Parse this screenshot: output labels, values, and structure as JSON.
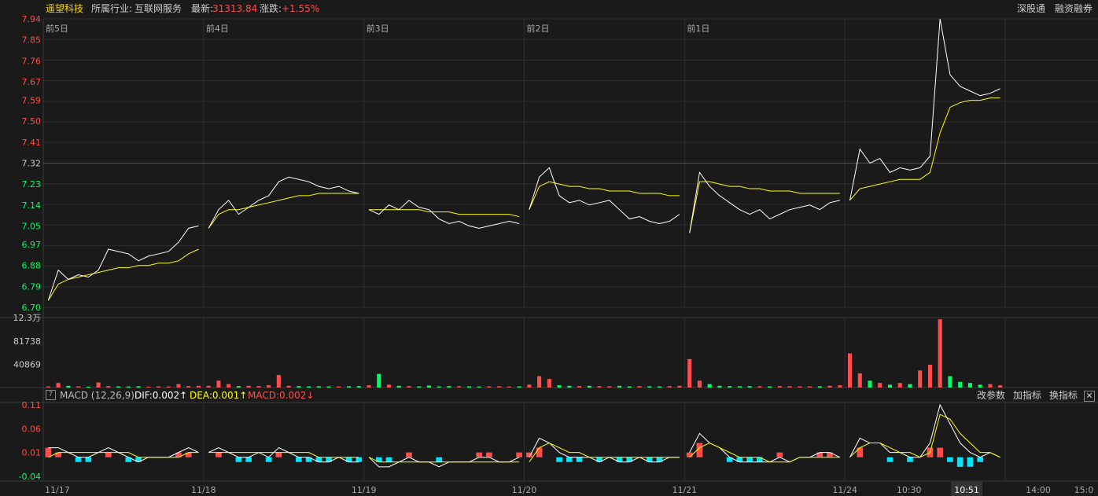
{
  "header": {
    "stock_name": "遥望科技",
    "industry_label": "所属行业:",
    "industry_value": "互联网服务",
    "latest_label": "最新:",
    "latest_value": "31313.84",
    "change_label": "涨跌:",
    "change_value": "+1.55%",
    "right_buttons": [
      "深股通",
      "融资融券"
    ]
  },
  "macd_bar": {
    "help_symbol": "?",
    "title": "MACD (12,26,9)",
    "dif": "DIF:0.002↑",
    "dea": "DEA:0.001↑",
    "macd": "MACD:0.002↓",
    "buttons": [
      "改参数",
      "加指标",
      "换指标"
    ],
    "close_symbol": "✕"
  },
  "colors": {
    "background": "#1a1a1a",
    "up": "#ff4d4d",
    "down": "#00ff66",
    "price_line": "#ffffff",
    "avg_line": "#ffff00",
    "macd_neg": "#00e5ff",
    "grid": "#2e2e2e"
  },
  "chart_data": [
    {
      "type": "line",
      "panel": "price",
      "yticks": [
        "7.94",
        "7.85",
        "7.76",
        "7.67",
        "7.59",
        "7.50",
        "7.41",
        "7.32",
        "7.23",
        "7.14",
        "7.05",
        "6.97",
        "6.88",
        "6.79",
        "6.70"
      ],
      "ylim": [
        6.7,
        7.94
      ],
      "reference_price": 7.32,
      "day_labels": [
        "前5日",
        "前4日",
        "前3日",
        "前2日",
        "前1日"
      ],
      "xticks": [
        "11/17",
        "11/18",
        "11/19",
        "11/20",
        "11/21",
        "11/24",
        "10:30",
        "10:51",
        "14:00",
        "15:0"
      ],
      "days": [
        {
          "price": [
            6.73,
            6.86,
            6.82,
            6.84,
            6.83,
            6.86,
            6.95,
            6.94,
            6.93,
            6.9,
            6.92,
            6.93,
            6.94,
            6.98,
            7.04,
            7.05
          ],
          "avg": [
            6.73,
            6.8,
            6.82,
            6.83,
            6.84,
            6.85,
            6.86,
            6.87,
            6.87,
            6.88,
            6.88,
            6.89,
            6.89,
            6.9,
            6.93,
            6.95
          ]
        },
        {
          "price": [
            7.04,
            7.12,
            7.16,
            7.1,
            7.13,
            7.16,
            7.18,
            7.24,
            7.26,
            7.25,
            7.24,
            7.22,
            7.21,
            7.22,
            7.2,
            7.19
          ],
          "avg": [
            7.04,
            7.1,
            7.12,
            7.12,
            7.13,
            7.14,
            7.15,
            7.16,
            7.17,
            7.18,
            7.18,
            7.19,
            7.19,
            7.19,
            7.19,
            7.19
          ]
        },
        {
          "price": [
            7.12,
            7.1,
            7.14,
            7.12,
            7.16,
            7.13,
            7.12,
            7.08,
            7.06,
            7.07,
            7.05,
            7.04,
            7.05,
            7.06,
            7.07,
            7.06
          ],
          "avg": [
            7.12,
            7.12,
            7.12,
            7.12,
            7.12,
            7.12,
            7.11,
            7.11,
            7.11,
            7.1,
            7.1,
            7.1,
            7.1,
            7.1,
            7.1,
            7.09
          ]
        },
        {
          "price": [
            7.12,
            7.26,
            7.3,
            7.18,
            7.15,
            7.16,
            7.14,
            7.15,
            7.16,
            7.12,
            7.08,
            7.09,
            7.07,
            7.06,
            7.07,
            7.1
          ],
          "avg": [
            7.12,
            7.22,
            7.24,
            7.23,
            7.22,
            7.22,
            7.21,
            7.21,
            7.2,
            7.2,
            7.2,
            7.19,
            7.19,
            7.19,
            7.18,
            7.18
          ]
        },
        {
          "price": [
            7.02,
            7.28,
            7.22,
            7.18,
            7.15,
            7.12,
            7.1,
            7.12,
            7.08,
            7.1,
            7.12,
            7.13,
            7.14,
            7.12,
            7.15,
            7.16
          ],
          "avg": [
            7.02,
            7.24,
            7.24,
            7.23,
            7.22,
            7.22,
            7.21,
            7.21,
            7.2,
            7.2,
            7.2,
            7.19,
            7.19,
            7.19,
            7.19,
            7.19
          ]
        },
        {
          "price": [
            7.16,
            7.38,
            7.32,
            7.34,
            7.28,
            7.3,
            7.29,
            7.3,
            7.35,
            7.94,
            7.7,
            7.65,
            7.63,
            7.61,
            7.62,
            7.64
          ],
          "avg": [
            7.16,
            7.21,
            7.22,
            7.23,
            7.24,
            7.25,
            7.25,
            7.25,
            7.28,
            7.45,
            7.56,
            7.58,
            7.59,
            7.59,
            7.6,
            7.6
          ]
        }
      ]
    },
    {
      "type": "bar",
      "panel": "volume",
      "yticks": [
        "12.3万",
        "81738",
        "40869"
      ],
      "ylim": [
        0,
        123000
      ],
      "days": [
        [
          2000,
          8000,
          3000,
          2000,
          1500,
          9000,
          2500,
          2000,
          1800,
          2200,
          1500,
          2000,
          1800,
          6000,
          2500,
          3000
        ],
        [
          3000,
          12000,
          6000,
          2500,
          3000,
          2500,
          4000,
          22000,
          3000,
          2500,
          2000,
          2200,
          2000,
          1800,
          2200,
          2500
        ],
        [
          4000,
          24000,
          5000,
          3000,
          2500,
          2000,
          3500,
          2000,
          2500,
          2200,
          2000,
          1800,
          2000,
          2200,
          1800,
          2000
        ],
        [
          5000,
          20000,
          15000,
          4000,
          3000,
          2500,
          3000,
          2500,
          2200,
          3000,
          2000,
          2500,
          2200,
          2000,
          2500,
          3000
        ],
        [
          50000,
          12000,
          6000,
          3000,
          2500,
          2200,
          2500,
          2200,
          2000,
          2500,
          2200,
          2000,
          2000,
          2200,
          3000,
          4000
        ],
        [
          60000,
          25000,
          12000,
          8000,
          5000,
          8000,
          6000,
          30000,
          40000,
          120000,
          20000,
          10000,
          8000,
          5000,
          6000,
          4000
        ]
      ]
    },
    {
      "type": "line",
      "panel": "macd",
      "yticks": [
        "0.11",
        "0.06",
        "0.01",
        "-0.04"
      ],
      "ylim": [
        -0.05,
        0.115
      ],
      "series": [
        {
          "name": "DIF",
          "days": [
            [
              0.02,
              0.02,
              0.01,
              0.0,
              0.0,
              0.01,
              0.02,
              0.01,
              0.0,
              -0.01,
              0.0,
              0.0,
              0.0,
              0.01,
              0.02,
              0.01
            ],
            [
              0.01,
              0.02,
              0.01,
              0.0,
              0.0,
              0.01,
              0.0,
              0.02,
              0.01,
              0.0,
              0.0,
              -0.01,
              -0.01,
              0.0,
              -0.01,
              -0.01
            ],
            [
              0.0,
              -0.02,
              -0.02,
              -0.01,
              0.0,
              -0.01,
              -0.01,
              -0.02,
              -0.01,
              -0.01,
              -0.01,
              0.0,
              0.0,
              -0.01,
              -0.01,
              0.0
            ],
            [
              0.0,
              0.04,
              0.03,
              0.01,
              0.0,
              0.0,
              0.0,
              -0.01,
              0.0,
              -0.01,
              -0.01,
              0.0,
              -0.01,
              -0.01,
              0.0,
              0.0
            ],
            [
              0.01,
              0.05,
              0.03,
              0.02,
              0.0,
              -0.01,
              -0.01,
              -0.01,
              -0.01,
              0.0,
              -0.01,
              0.0,
              0.0,
              0.01,
              0.01,
              0.0
            ],
            [
              0.0,
              0.04,
              0.03,
              0.03,
              0.01,
              0.01,
              0.0,
              0.0,
              0.03,
              0.11,
              0.07,
              0.03,
              0.01,
              0.0,
              0.01,
              0.0
            ]
          ]
        },
        {
          "name": "DEA",
          "days": [
            [
              0.0,
              0.01,
              0.01,
              0.01,
              0.01,
              0.01,
              0.01,
              0.01,
              0.01,
              0.0,
              0.0,
              0.0,
              0.0,
              0.0,
              0.01,
              0.01
            ],
            [
              0.01,
              0.01,
              0.01,
              0.01,
              0.01,
              0.01,
              0.01,
              0.01,
              0.01,
              0.01,
              0.01,
              0.0,
              0.0,
              0.0,
              0.0,
              0.0
            ],
            [
              0.0,
              -0.01,
              -0.01,
              -0.01,
              -0.01,
              -0.01,
              -0.01,
              -0.01,
              -0.01,
              -0.01,
              -0.01,
              -0.01,
              -0.01,
              -0.01,
              -0.01,
              -0.01
            ],
            [
              -0.01,
              0.02,
              0.03,
              0.02,
              0.01,
              0.01,
              0.0,
              0.0,
              0.0,
              0.0,
              0.0,
              0.0,
              0.0,
              0.0,
              0.0,
              0.0
            ],
            [
              0.0,
              0.02,
              0.03,
              0.02,
              0.01,
              0.0,
              0.0,
              0.0,
              -0.01,
              -0.01,
              -0.01,
              0.0,
              0.0,
              0.0,
              0.0,
              0.0
            ],
            [
              0.0,
              0.02,
              0.03,
              0.03,
              0.02,
              0.01,
              0.01,
              0.0,
              0.01,
              0.09,
              0.08,
              0.05,
              0.03,
              0.01,
              0.01,
              0.0
            ]
          ]
        },
        {
          "name": "MACD",
          "days": [
            [
              0.02,
              0.01,
              0.0,
              -0.01,
              -0.01,
              0.0,
              0.01,
              0.0,
              -0.01,
              -0.01,
              0.0,
              0.0,
              0.0,
              0.01,
              0.01,
              0.0
            ],
            [
              0.0,
              0.01,
              0.0,
              -0.01,
              -0.01,
              0.0,
              -0.01,
              0.01,
              0.0,
              -0.01,
              -0.01,
              -0.01,
              -0.01,
              0.0,
              -0.01,
              -0.01
            ],
            [
              0.0,
              -0.01,
              -0.01,
              0.0,
              0.01,
              0.0,
              0.0,
              -0.01,
              0.0,
              0.0,
              0.0,
              0.01,
              0.01,
              0.0,
              0.0,
              0.01
            ],
            [
              0.01,
              0.02,
              0.0,
              -0.01,
              -0.01,
              -0.01,
              0.0,
              -0.01,
              0.0,
              -0.01,
              -0.01,
              0.0,
              -0.01,
              -0.01,
              0.0,
              0.0
            ],
            [
              0.01,
              0.03,
              0.0,
              0.0,
              -0.01,
              -0.01,
              -0.01,
              -0.01,
              0.0,
              0.01,
              0.0,
              0.0,
              0.0,
              0.01,
              0.01,
              0.0
            ],
            [
              0.0,
              0.02,
              0.0,
              0.0,
              -0.01,
              0.0,
              -0.01,
              0.0,
              0.02,
              0.02,
              -0.01,
              -0.02,
              -0.02,
              -0.01,
              0.0,
              0.0
            ]
          ]
        }
      ]
    }
  ]
}
